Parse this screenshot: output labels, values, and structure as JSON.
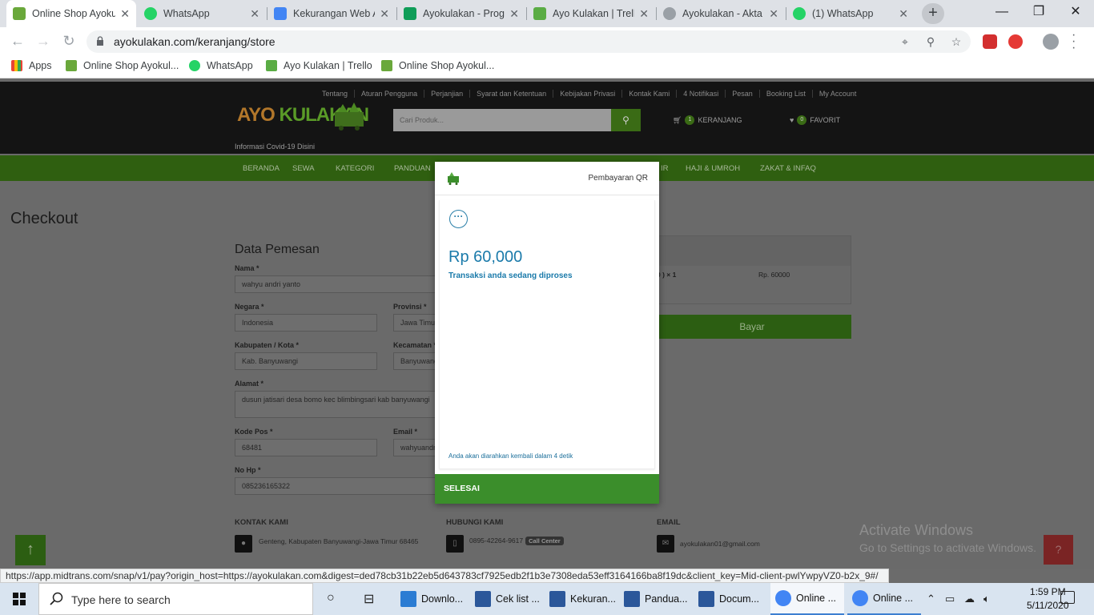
{
  "browser": {
    "tabs": [
      {
        "title": "Online Shop Ayokulakan",
        "active": true,
        "color": "#6aa83b"
      },
      {
        "title": "WhatsApp",
        "color": "#25d366"
      },
      {
        "title": "Kekurangan Web Ayokulakan",
        "color": "#4285f4"
      },
      {
        "title": "Ayokulakan - Progress",
        "color": "#0f9d58"
      },
      {
        "title": "Ayo Kulakan | Trello",
        "color": "#5aac44"
      },
      {
        "title": "Ayokulakan - Akta",
        "color": "#9aa0a6"
      },
      {
        "title": "(1) WhatsApp",
        "color": "#25d366"
      }
    ],
    "url": "ayokulakan.com/keranjang/store",
    "bookmarks": [
      {
        "label": "Apps"
      },
      {
        "label": "Online Shop Ayokul..."
      },
      {
        "label": "WhatsApp"
      },
      {
        "label": "Ayo Kulakan | Trello"
      },
      {
        "label": "Online Shop Ayokul..."
      }
    ],
    "status_url": "https://app.midtrans.com/snap/v1/pay?origin_host=https://ayokulakan.com&digest=ded78cb31b22eb5d643783cf7925edb2f1b3e7308eda53eff3164166ba8f19dc&client_key=Mid-client-pwlYwpyVZ0-b2x_9#/"
  },
  "site": {
    "toplinks": [
      "Tentang",
      "Aturan Pengguna",
      "Perjanjian",
      "Syarat dan Ketentuan",
      "Kebijakan Privasi",
      "Kontak Kami",
      "4 Notifikasi",
      "Pesan",
      "Booking List",
      "My Account"
    ],
    "logo_ayo": "AYO",
    "logo_kulakan": "KULAKAN",
    "covid": "Informasi Covid-19 Disini",
    "search_placeholder": "Cari Produk...",
    "cart_count": "1",
    "cart_label": "KERANJANG",
    "fav_count": "0",
    "fav_label": "FAVORIT",
    "nav": [
      "BERANDA",
      "SEWA",
      "KATEGORI",
      "PANDUAN",
      "IR",
      "HAJI & UMROH",
      "ZAKAT & INFAQ"
    ],
    "checkout_title": "Checkout",
    "form_title": "Data Pemesan",
    "form": {
      "nama_label": "Nama *",
      "nama": "wahyu andri yanto",
      "negara_label": "Negara *",
      "negara": "Indonesia",
      "provinsi_label": "Provinsi *",
      "provinsi": "Jawa Timur",
      "kabupaten_label": "Kabupaten / Kota *",
      "kabupaten": "Kab. Banyuwangi",
      "kecamatan_label": "Kecamatan *",
      "kecamatan": "Banyuwangi",
      "alamat_label": "Alamat *",
      "alamat": "dusun jatisari desa bomo kec blimbingsari kab banyuwangi",
      "kodepos_label": "Kode Pos *",
      "kodepos": "68481",
      "email_label": "Email *",
      "email": "wahyuandri",
      "nohp_label": "No Hp *",
      "nohp": "085236165322"
    },
    "summary": {
      "qty": "0 ) × 1",
      "price": "Rp. 60000"
    },
    "bayar": "Bayar",
    "footer": {
      "kontak_title": "KONTAK KAMI",
      "kontak": "Genteng, Kabupaten Banyuwangi-Jawa Timur 68465",
      "hubungi_title": "HUBUNGI KAMI",
      "phone": "0895-42264-9617",
      "cc": "Call Center",
      "email_title": "EMAIL",
      "email": "ayokulakan01@gmail.com"
    }
  },
  "modal": {
    "title": "Pembayaran QR",
    "amount": "Rp 60,000",
    "status": "Transaksi anda sedang diproses",
    "redirect": "Anda akan diarahkan kembali dalam 4 detik",
    "button": "SELESAI"
  },
  "windows": {
    "activate_title": "Activate Windows",
    "activate_sub": "Go to Settings to activate Windows.",
    "search": "Type here to search",
    "apps": [
      {
        "label": "Downlo...",
        "color": "#2b7cd3"
      },
      {
        "label": "Cek list ...",
        "color": "#2b579a"
      },
      {
        "label": "Kekuran...",
        "color": "#2b579a"
      },
      {
        "label": "Pandua...",
        "color": "#2b579a"
      },
      {
        "label": "Docum...",
        "color": "#2b579a"
      },
      {
        "label": "Online ...",
        "color": "#4285f4"
      },
      {
        "label": "Online ...",
        "color": "#4285f4"
      }
    ],
    "time": "1:59 PM",
    "date": "5/11/2020"
  }
}
